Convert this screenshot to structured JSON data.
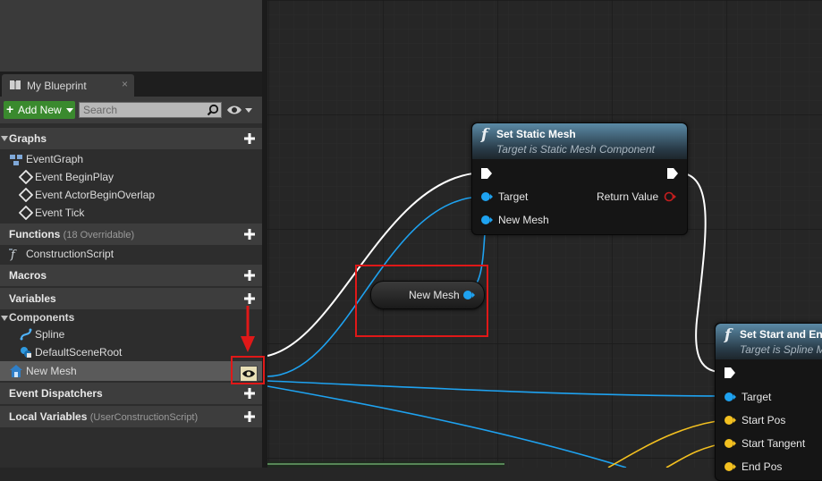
{
  "panel": {
    "tab_title": "My Blueprint",
    "tab_close": "×",
    "add_new_label": "Add New",
    "search_placeholder": "Search",
    "sections": {
      "graphs": "Graphs",
      "functions": "Functions",
      "functions_count": "(18 Overridable)",
      "macros": "Macros",
      "variables": "Variables",
      "event_dispatchers": "Event Dispatchers",
      "local_variables": "Local Variables",
      "local_variables_scope": "(UserConstructionScript)"
    },
    "graph_items": [
      "EventGraph",
      "Event BeginPlay",
      "Event ActorBeginOverlap",
      "Event Tick"
    ],
    "function_items": [
      "ConstructionScript"
    ],
    "components_category": "Components",
    "component_items": [
      "Spline",
      "DefaultSceneRoot"
    ],
    "variable_items": [
      "New Mesh"
    ]
  },
  "graph": {
    "set_static_mesh": {
      "func_icon": "f",
      "title": "Set Static Mesh",
      "subtitle": "Target is Static Mesh Component",
      "pins": {
        "target": "Target",
        "new_mesh": "New Mesh",
        "return_value": "Return Value"
      }
    },
    "new_mesh_getter": {
      "label": "New Mesh"
    },
    "set_start_end": {
      "func_icon": "f",
      "title": "Set Start and En",
      "subtitle": "Target is Spline M",
      "pins": {
        "target": "Target",
        "start_pos": "Start Pos",
        "start_tangent": "Start Tangent",
        "end_pos": "End Pos"
      }
    }
  },
  "colors": {
    "graph_bg": "#262626",
    "exec_wire": "#ffffff",
    "object_pin": "#1ea2f0",
    "vector_pin": "#f3c020",
    "return_pin": "#c41e1e",
    "highlight": "#e01818",
    "add_new": "#3a8a2e"
  },
  "icons": [
    "book-icon",
    "plus-icon",
    "search-icon",
    "eye-icon",
    "graph-icon",
    "event-icon",
    "function-icon",
    "spline-icon",
    "scene-root-icon",
    "variable-component-icon",
    "visibility-eye-icon",
    "annotation-arrow"
  ]
}
